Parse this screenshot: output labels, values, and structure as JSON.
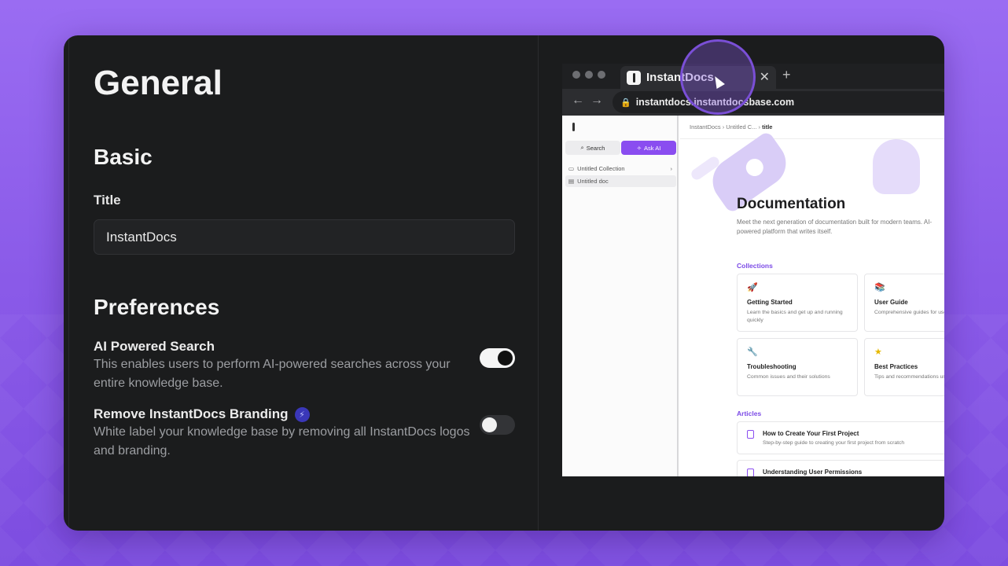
{
  "settings": {
    "page_title": "General",
    "basic_heading": "Basic",
    "title_label": "Title",
    "title_value": "InstantDocs",
    "preferences_heading": "Preferences",
    "ai_search": {
      "title": "AI Powered Search",
      "description": "This enables users to perform AI-powered searches across your entire knowledge base.",
      "enabled": true
    },
    "branding": {
      "title": "Remove InstantDocs Branding",
      "description": "White label your knowledge base by removing all InstantDocs logos and branding.",
      "enabled": false,
      "badge_icon": "bolt-icon"
    }
  },
  "browser": {
    "tab_title": "InstantDocs",
    "url": "instantdocs.instantdocsbase.com",
    "sidebar": {
      "search_label": "Search",
      "ask_ai_label": "Ask AI",
      "items": [
        {
          "label": "Untitled Collection",
          "icon": "folder-icon"
        },
        {
          "label": "Untitled doc",
          "icon": "doc-icon"
        }
      ]
    },
    "breadcrumb": [
      "InstantDocs",
      "Untitled C...",
      "title"
    ],
    "doc_title": "Documentation",
    "doc_subtitle": "Meet the next generation of documentation built for modern teams. AI-powered platform that writes itself.",
    "collections_label": "Collections",
    "collections": [
      {
        "title": "Getting Started",
        "desc": "Learn the basics and get up and running quickly",
        "icon": "rocket-icon"
      },
      {
        "title": "User Guide",
        "desc": "Comprehensive guides for users",
        "icon": "book-icon"
      },
      {
        "title": "Troubleshooting",
        "desc": "Common issues and their solutions",
        "icon": "wrench-icon"
      },
      {
        "title": "Best Practices",
        "desc": "Tips and recommendations usage",
        "icon": "star-icon"
      }
    ],
    "articles_label": "Articles",
    "articles": [
      {
        "title": "How to Create Your First Project",
        "desc": "Step-by-step guide to creating your first project from scratch"
      },
      {
        "title": "Understanding User Permissions",
        "desc": ""
      }
    ]
  },
  "colors": {
    "accent": "#8a4df0",
    "background": "#8a5ae8",
    "card": "#1b1c1d"
  }
}
